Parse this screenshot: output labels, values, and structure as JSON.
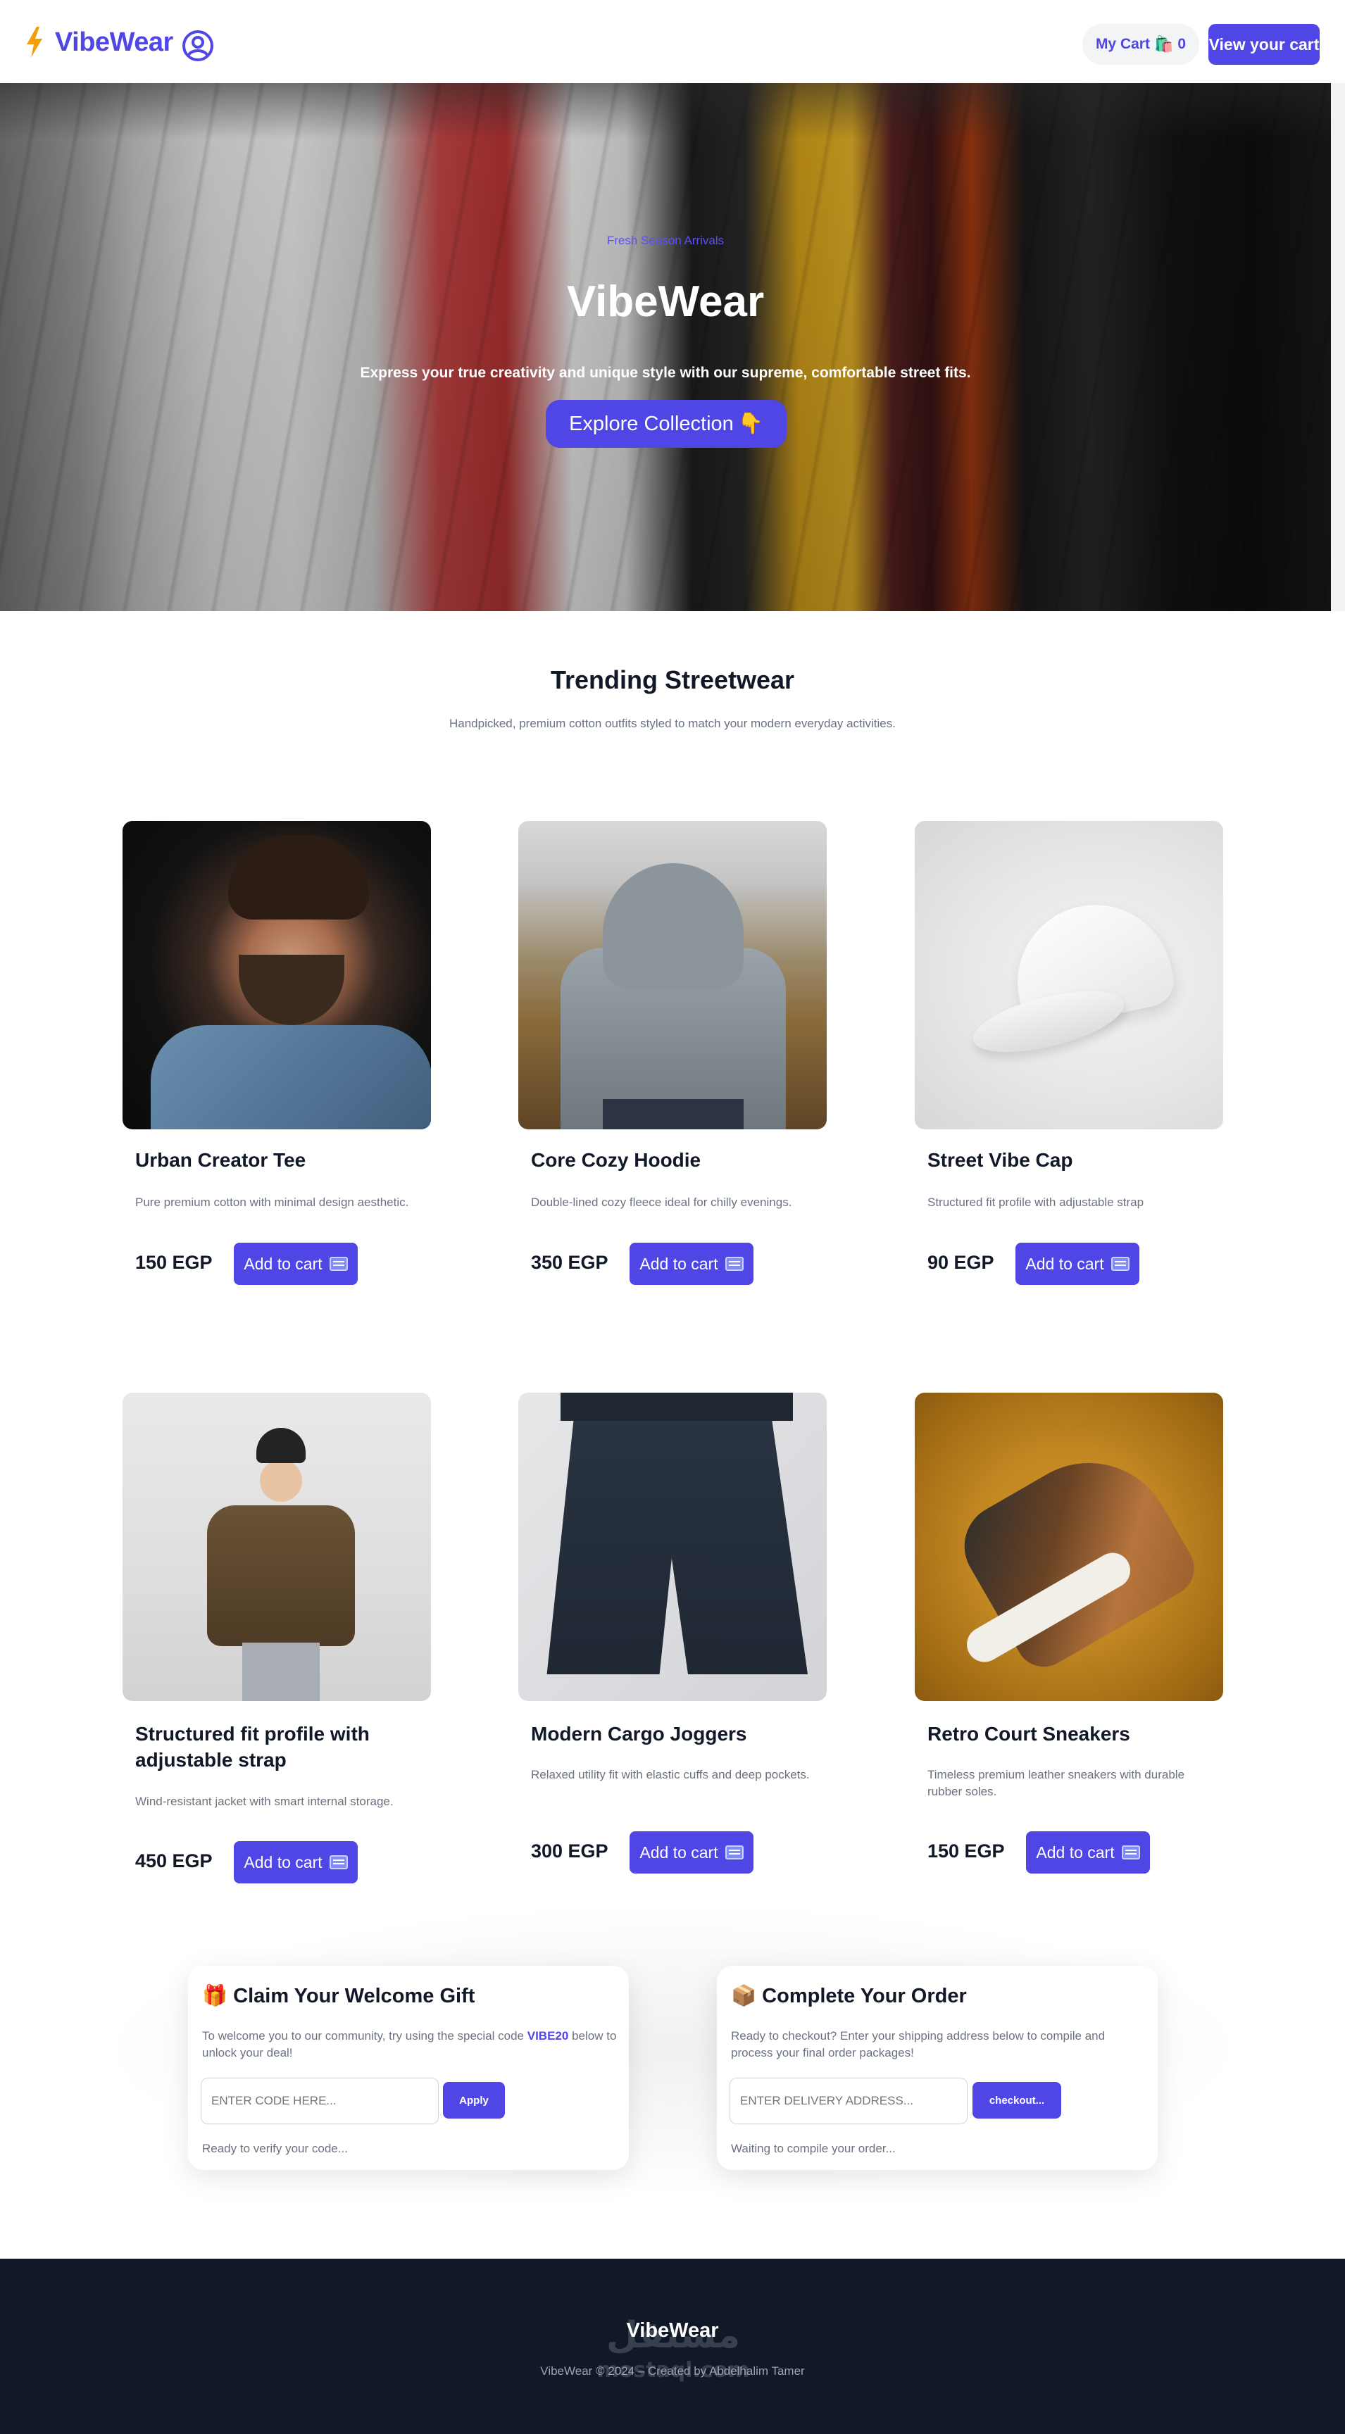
{
  "header": {
    "brand": "VibeWear",
    "cart_label": "My Cart",
    "cart_emoji": "🛍️",
    "cart_count": "0",
    "view_cart_label": "View your cart"
  },
  "hero": {
    "eyebrow": "Fresh Season Arrivals",
    "title": "VibeWear",
    "subtitle": "Express your true creativity and unique style with our supreme, comfortable street fits.",
    "cta_label": "Explore Collection",
    "cta_emoji": "👇"
  },
  "trending": {
    "title": "Trending Streetwear",
    "subtitle": "Handpicked, premium cotton outfits styled to match your modern everyday activities."
  },
  "products": [
    {
      "name": "Urban Creator Tee",
      "desc": "Pure premium cotton with minimal design aesthetic.",
      "price": "150 EGP",
      "button": "Add to cart"
    },
    {
      "name": "Core Cozy Hoodie",
      "desc": "Double-lined cozy fleece ideal for chilly evenings.",
      "price": "350 EGP",
      "button": "Add to cart"
    },
    {
      "name": "Street Vibe Cap",
      "desc": "Structured fit profile with adjustable strap",
      "price": "90 EGP",
      "button": "Add to cart"
    },
    {
      "name": "Structured fit profile with adjustable strap",
      "desc": "Wind-resistant jacket with smart internal storage.",
      "price": "450 EGP",
      "button": "Add to cart"
    },
    {
      "name": "Modern Cargo Joggers",
      "desc": "Relaxed utility fit with elastic cuffs and deep pockets.",
      "price": "300 EGP",
      "button": "Add to cart"
    },
    {
      "name": "Retro Court Sneakers",
      "desc": "Timeless premium leather sneakers with durable rubber soles.",
      "price": "150 EGP",
      "button": "Add to cart"
    }
  ],
  "promo": {
    "emoji": "🎁",
    "title": "Claim Your Welcome Gift",
    "text_before": "To welcome you to our community, try using the special code",
    "code": "VIBE20",
    "text_after": "below to unlock your deal!",
    "placeholder": "ENTER CODE HERE...",
    "button": "Apply",
    "status": "Ready to verify your code..."
  },
  "order": {
    "emoji": "📦",
    "title": "Complete Your Order",
    "text": "Ready to checkout? Enter your shipping address below to compile and process your final order packages!",
    "placeholder": "ENTER DELIVERY ADDRESS...",
    "button": "checkout...",
    "status": "Waiting to compile your order..."
  },
  "footer": {
    "brand": "VibeWear",
    "text": "VibeWear © 2024 – Created by Abdelhalim Tamer",
    "watermark": "مستقل mostaql.com"
  },
  "colors": {
    "accent": "#4f46e5",
    "bolt": "#f59e0b",
    "footer_bg": "#111827"
  }
}
